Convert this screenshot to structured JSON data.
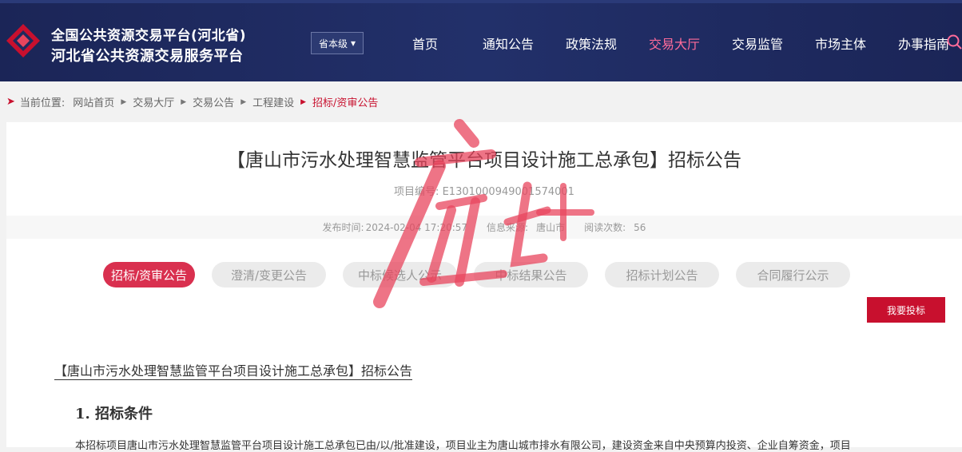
{
  "header": {
    "brand_line1": "全国公共资源交易平台(河北省)",
    "brand_line2": "河北省公共资源交易服务平台",
    "level_select": "省本级",
    "nav": [
      "首页",
      "通知公告",
      "政策法规",
      "交易大厅",
      "交易监管",
      "市场主体",
      "办事指南"
    ],
    "active_nav": "交易大厅"
  },
  "breadcrumb": {
    "prefix": "当前位置:",
    "items": [
      "网站首页",
      "交易大厅",
      "交易公告",
      "工程建设"
    ],
    "current": "招标/资审公告"
  },
  "article": {
    "title": "【唐山市污水处理智慧监管平台项目设计施工总承包】招标公告",
    "project_no_label": "项目编号:",
    "project_no": "E1301000949001574001",
    "publish_label": "发布时间:",
    "publish_time": "2024-02-04 17:20:57",
    "source_label": "信息来源:",
    "source": "唐山市",
    "views_label": "阅读次数:",
    "views": "56"
  },
  "tabs": [
    "招标/资审公告",
    "澄清/变更公告",
    "中标候选人公示",
    "中标结果公告",
    "招标计划公告",
    "合同履行公示"
  ],
  "active_tab": "招标/资审公告",
  "bid_button": "我要投标",
  "content": {
    "doc_title": "【唐山市污水处理智慧监管平台项目设计施工总承包】招标公告",
    "section1": "1.  招标条件",
    "paragraph1": "本招标项目唐山市污水处理智慧监管平台项目设计施工总承包已由/以/批准建设，项目业主为唐山城市排水有限公司，建设资金来自中央预算内投资、企业自筹资金，项目"
  },
  "colors": {
    "header_bg": "#1e2a5e",
    "accent_red": "#c8102e",
    "active_nav": "#ff6b9a",
    "active_tab": "#d9304f"
  }
}
